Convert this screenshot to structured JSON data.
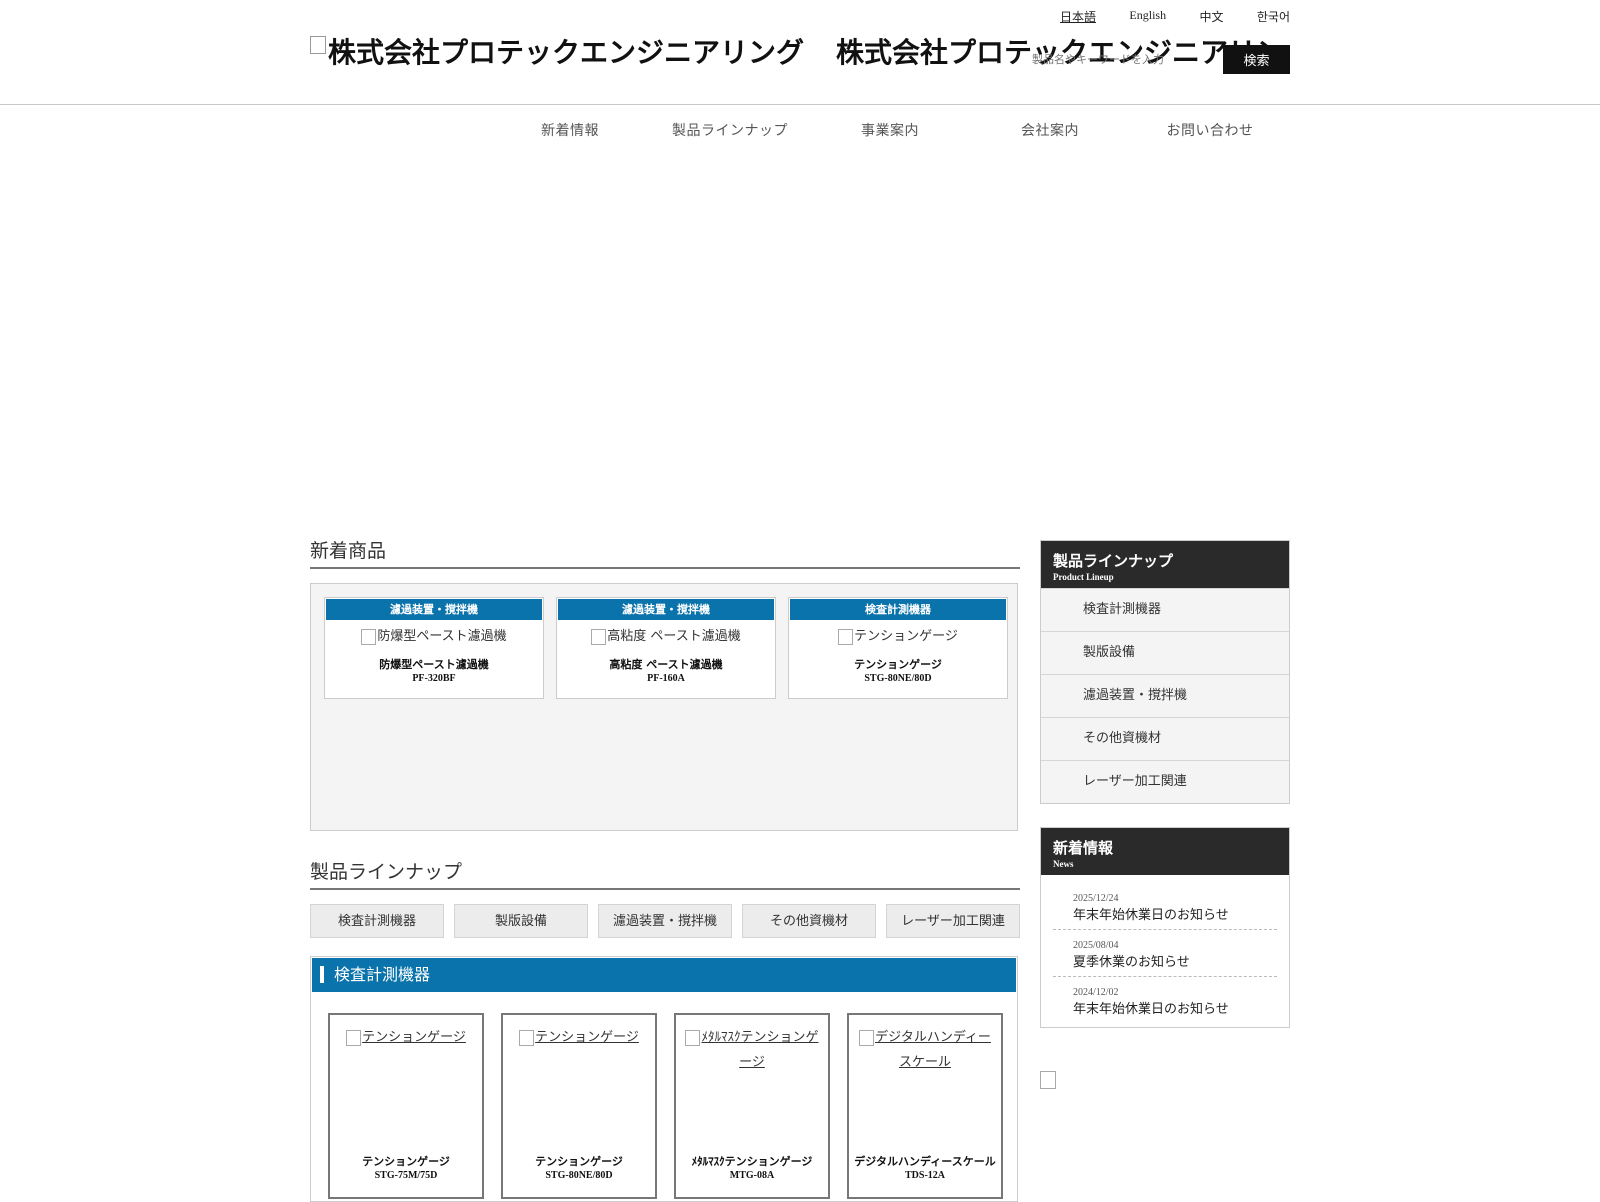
{
  "header": {
    "languages": [
      "日本語",
      "English",
      "中文",
      "한국어"
    ],
    "logo_alt": "株式会社プロテックエンジニアリング",
    "logo_text": "株式会社プロテックエンジニアリング",
    "search_placeholder": "製品名やキーワードを入力",
    "search_button": "検索"
  },
  "nav": [
    "新着情報",
    "製品ラインナップ",
    "事業案内",
    "会社案内",
    "お問い合わせ"
  ],
  "new_products": {
    "heading": "新着商品",
    "items": [
      {
        "category": "濾過装置・撹拌機",
        "image_alt": "防爆型ペースト濾過機",
        "name": "防爆型ペースト濾過機",
        "model": "PF-320BF"
      },
      {
        "category": "濾過装置・撹拌機",
        "image_alt": "高粘度 ペースト濾過機",
        "name": "高粘度 ペースト濾過機",
        "model": "PF-160A"
      },
      {
        "category": "検査計測機器",
        "image_alt": "テンションゲージ",
        "name": "テンションゲージ",
        "model": "STG-80NE/80D"
      }
    ]
  },
  "lineup": {
    "heading": "製品ラインナップ",
    "tabs": [
      "検査計測機器",
      "製版設備",
      "濾過装置・撹拌機",
      "その他資機材",
      "レーザー加工関連"
    ],
    "category_title": "検査計測機器",
    "items": [
      {
        "image_alt": "テンションゲージ",
        "name": "テンションゲージ",
        "model": "STG-75M/75D"
      },
      {
        "image_alt": "テンションゲージ",
        "name": "テンションゲージ",
        "model": "STG-80NE/80D"
      },
      {
        "image_alt": "ﾒﾀﾙﾏｽｸテンションゲージ",
        "name": "ﾒﾀﾙﾏｽｸテンションゲージ",
        "model": "MTG-08A"
      },
      {
        "image_alt": "デジタルハンディースケール",
        "name": "デジタルハンディースケール",
        "model": "TDS-12A"
      }
    ]
  },
  "sidebar": {
    "lineup": {
      "title": "製品ラインナップ",
      "subtitle": "Product Lineup",
      "items": [
        "検査計測機器",
        "製版設備",
        "濾過装置・撹拌機",
        "その他資機材",
        "レーザー加工関連"
      ]
    },
    "news": {
      "title": "新着情報",
      "subtitle": "News",
      "items": [
        {
          "date": "2025/12/24",
          "title": "年末年始休業日のお知らせ"
        },
        {
          "date": "2025/08/04",
          "title": "夏季休業のお知らせ"
        },
        {
          "date": "2024/12/02",
          "title": "年末年始休業日のお知らせ"
        }
      ]
    }
  },
  "colors": {
    "accent_blue": "#0a73ab",
    "dark_header": "#2a2a2a",
    "button_black": "#111111"
  }
}
